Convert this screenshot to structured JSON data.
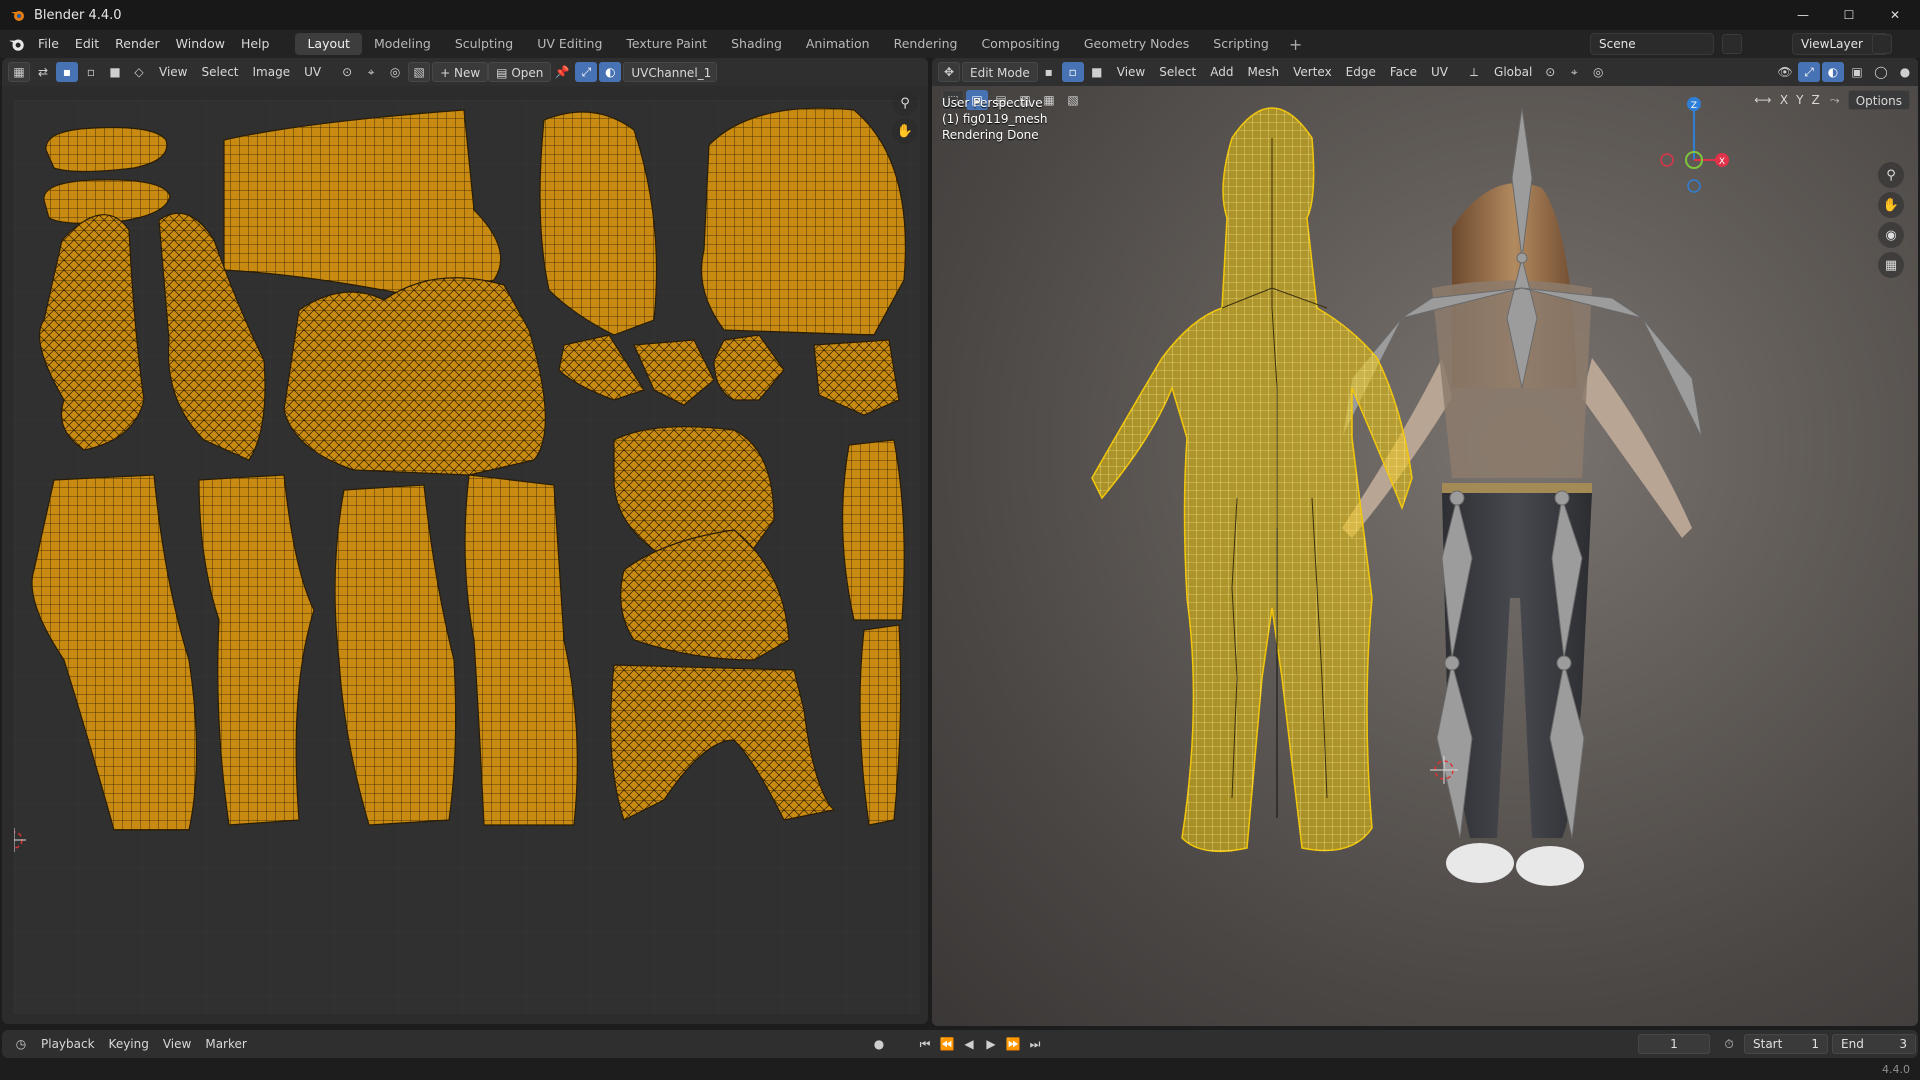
{
  "window": {
    "title": "Blender 4.4.0",
    "minimize": "—",
    "maximize": "☐",
    "close": "✕"
  },
  "menu": {
    "items": [
      "File",
      "Edit",
      "Render",
      "Window",
      "Help"
    ]
  },
  "workspaces": {
    "tabs": [
      "Layout",
      "Modeling",
      "Sculpting",
      "UV Editing",
      "Texture Paint",
      "Shading",
      "Animation",
      "Rendering",
      "Compositing",
      "Geometry Nodes",
      "Scripting"
    ],
    "active": "Layout",
    "add": "+"
  },
  "scene": {
    "label": "Scene",
    "view_layer": "ViewLayer"
  },
  "uv_editor": {
    "header": {
      "view": "View",
      "select": "Select",
      "image": "Image",
      "uv": "UV",
      "new": "New",
      "open": "Open",
      "uv_map": "UVChannel_1"
    }
  },
  "viewport": {
    "header": {
      "mode": "Edit Mode",
      "view": "View",
      "select": "Select",
      "add": "Add",
      "mesh": "Mesh",
      "vertex": "Vertex",
      "edge": "Edge",
      "face": "Face",
      "uv": "UV",
      "transform": "Global",
      "options": "Options",
      "axis_x": "X",
      "axis_y": "Y",
      "axis_z": "Z"
    },
    "info": {
      "perspective": "User Perspective",
      "object": "(1) fig0119_mesh",
      "status": "Rendering Done"
    },
    "gizmo": {
      "z": "Z",
      "y": "Y",
      "x": "X"
    }
  },
  "timeline": {
    "playback": "Playback",
    "keying": "Keying",
    "view": "View",
    "marker": "Marker",
    "current_frame": "1",
    "start_label": "Start",
    "start": "1",
    "end_label": "End",
    "end": "3"
  },
  "status": {
    "version": "4.4.0"
  },
  "colors": {
    "uv_island": "#c98a12",
    "mesh_wire": "#f1c60a",
    "active_blue": "#4772b3",
    "axis_x": "#e0334a",
    "axis_y": "#7ec63a",
    "axis_z": "#2f7fd6"
  }
}
